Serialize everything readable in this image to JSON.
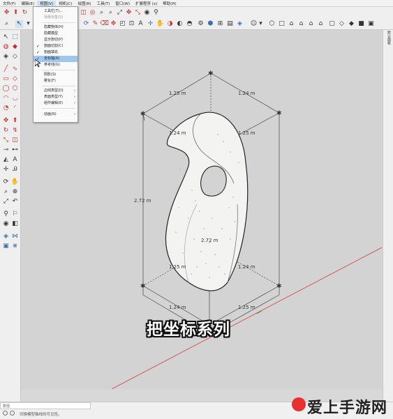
{
  "menubar": {
    "items": [
      "文件(F)",
      "编辑(E)",
      "视图(V)",
      "相机(C)",
      "绘图(R)",
      "工具(T)",
      "窗口(W)",
      "扩展程序 (x)",
      "帮助(H)"
    ]
  },
  "view_menu": {
    "items": [
      {
        "label": "工具栏(T)...",
        "state": "normal"
      },
      {
        "label": "场景标签(S)",
        "state": "disabled"
      },
      {
        "label": "隐藏物体(H)",
        "state": "normal"
      },
      {
        "label": "隐藏模型",
        "state": "normal"
      },
      {
        "label": "显示剖切(P)",
        "state": "normal"
      },
      {
        "label": "剖面切割(C)",
        "state": "checked"
      },
      {
        "label": "剖面填充",
        "state": "checked"
      },
      {
        "label": "坐标轴(A)",
        "state": "highlighted"
      },
      {
        "label": "参考线(G)",
        "state": "normal"
      },
      {
        "label": "阴影(S)",
        "state": "normal"
      },
      {
        "label": "雾化(F)",
        "state": "normal"
      },
      {
        "label": "边线类型(D)",
        "state": "submenu"
      },
      {
        "label": "表面类型(Y)",
        "state": "submenu"
      },
      {
        "label": "组件编辑(E)",
        "state": "submenu"
      },
      {
        "label": "动画(N)",
        "state": "submenu"
      }
    ]
  },
  "dimensions": {
    "top_left": "1.25 m",
    "top_right": "1.24 m",
    "mid_left": "1.24 m",
    "mid_right": "1.25 m",
    "height_left": "2.72 m",
    "height_center": "2.72 m",
    "low_left": "1.25 m",
    "low_right": "1.24 m",
    "bottom_left": "1.24 m",
    "bottom_right": "1.25 m"
  },
  "caption": "把坐标系列",
  "right_panel": {
    "label": "默认面板"
  },
  "status": {
    "measure_label": "数值",
    "hint": "切换模型轴线的可见性。"
  },
  "watermark": {
    "text": "爱上手游网"
  },
  "colors": {
    "accent_red": "#c9302c",
    "highlight": "#9fc7ee",
    "red_axis": "#cf3b3b",
    "green_axis": "#3aa043"
  }
}
